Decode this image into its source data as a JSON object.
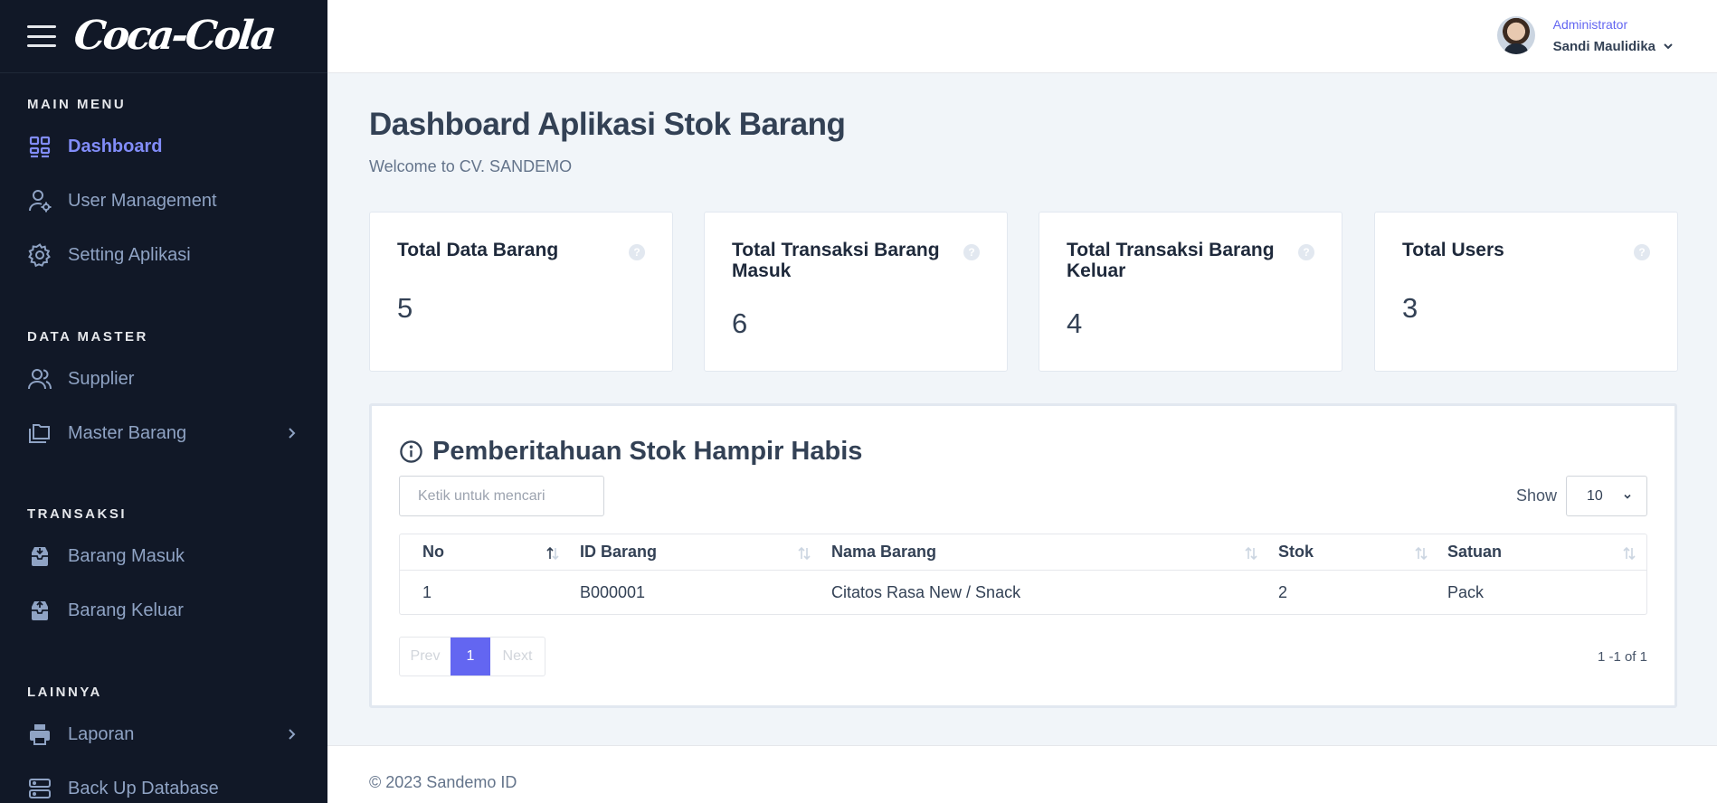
{
  "brand": {
    "logo_text": "Coca-Cola"
  },
  "sidebar": {
    "sections": [
      {
        "title": "MAIN MENU"
      },
      {
        "title": "DATA MASTER"
      },
      {
        "title": "TRANSAKSI"
      },
      {
        "title": "LAINNYA"
      }
    ],
    "items": [
      {
        "label": "Dashboard",
        "icon": "dashboard-icon",
        "active": true
      },
      {
        "label": "User Management",
        "icon": "user-gear-icon"
      },
      {
        "label": "Setting Aplikasi",
        "icon": "gear-icon"
      },
      {
        "label": "Supplier",
        "icon": "users-icon"
      },
      {
        "label": "Master Barang",
        "icon": "folders-icon",
        "has_submenu": true
      },
      {
        "label": "Barang Masuk",
        "icon": "inbox-in-icon"
      },
      {
        "label": "Barang Keluar",
        "icon": "inbox-out-icon"
      },
      {
        "label": "Laporan",
        "icon": "printer-icon",
        "has_submenu": true
      },
      {
        "label": "Back Up Database",
        "icon": "server-icon"
      }
    ]
  },
  "user": {
    "role": "Administrator",
    "name": "Sandi Maulidika"
  },
  "page": {
    "title": "Dashboard Aplikasi Stok Barang",
    "subtitle": "Welcome to CV. SANDEMO"
  },
  "cards": [
    {
      "title": "Total Data Barang",
      "value": "5"
    },
    {
      "title": "Total Transaksi Barang Masuk",
      "value": "6"
    },
    {
      "title": "Total Transaksi Barang Keluar",
      "value": "4"
    },
    {
      "title": "Total Users",
      "value": "3"
    }
  ],
  "stock_panel": {
    "title": "Pemberitahuan Stok Hampir Habis",
    "search_placeholder": "Ketik untuk mencari",
    "show_label": "Show",
    "show_value": "10",
    "columns": [
      "No",
      "ID Barang",
      "Nama Barang",
      "Stok",
      "Satuan"
    ],
    "rows": [
      [
        "1",
        "B000001",
        "Citatos Rasa New / Snack",
        "2",
        "Pack"
      ]
    ],
    "pagination": {
      "prev": "Prev",
      "current": "1",
      "next": "Next",
      "info": "1 -1 of 1"
    }
  },
  "footer": {
    "text": "© 2023 Sandemo ID"
  },
  "colors": {
    "sidebar_bg": "#111827",
    "accent": "#6366f1",
    "active_text": "#818cf8",
    "muted_text": "#8fa3c4"
  }
}
